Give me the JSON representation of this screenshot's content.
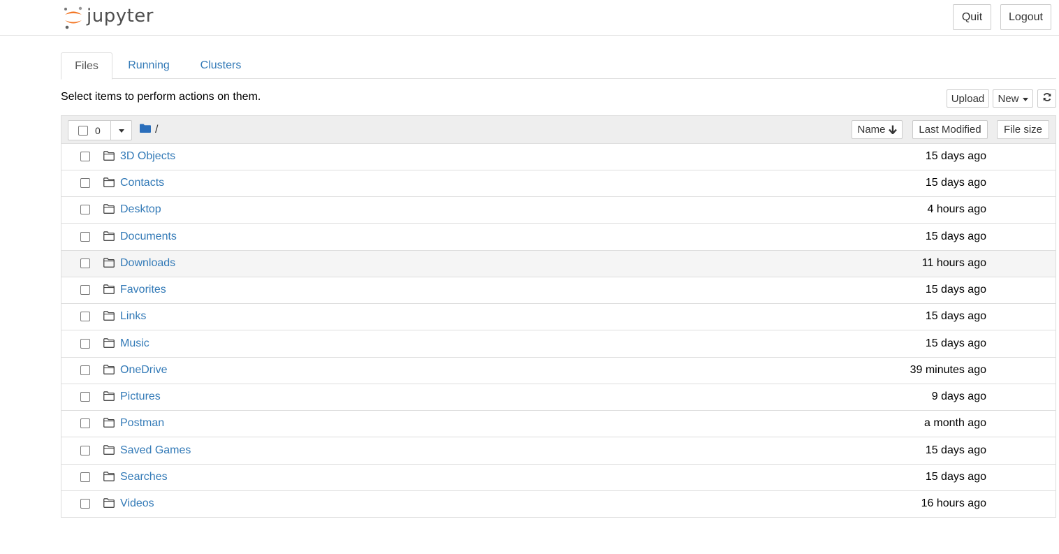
{
  "header": {
    "logo_text": "jupyter",
    "quit_label": "Quit",
    "logout_label": "Logout",
    "logo_colors": [
      "#f37726",
      "#767677",
      "#989798"
    ]
  },
  "tabs": [
    {
      "label": "Files",
      "active": true
    },
    {
      "label": "Running",
      "active": false
    },
    {
      "label": "Clusters",
      "active": false
    }
  ],
  "toolbar": {
    "hint": "Select items to perform actions on them.",
    "upload_label": "Upload",
    "new_label": "New",
    "refresh_icon": "refresh-icon"
  },
  "list_header": {
    "selected_count": "0",
    "breadcrumb_path": "/",
    "breadcrumb_icon": "folder-icon",
    "sort_name": "Name",
    "sort_modified": "Last Modified",
    "sort_size": "File size"
  },
  "accent_color": "#337ab7",
  "items": [
    {
      "name": "3D Objects",
      "modified": "15 days ago"
    },
    {
      "name": "Contacts",
      "modified": "15 days ago"
    },
    {
      "name": "Desktop",
      "modified": "4 hours ago"
    },
    {
      "name": "Documents",
      "modified": "15 days ago"
    },
    {
      "name": "Downloads",
      "modified": "11 hours ago"
    },
    {
      "name": "Favorites",
      "modified": "15 days ago"
    },
    {
      "name": "Links",
      "modified": "15 days ago"
    },
    {
      "name": "Music",
      "modified": "15 days ago"
    },
    {
      "name": "OneDrive",
      "modified": "39 minutes ago"
    },
    {
      "name": "Pictures",
      "modified": "9 days ago"
    },
    {
      "name": "Postman",
      "modified": "a month ago"
    },
    {
      "name": "Saved Games",
      "modified": "15 days ago"
    },
    {
      "name": "Searches",
      "modified": "15 days ago"
    },
    {
      "name": "Videos",
      "modified": "16 hours ago"
    }
  ]
}
